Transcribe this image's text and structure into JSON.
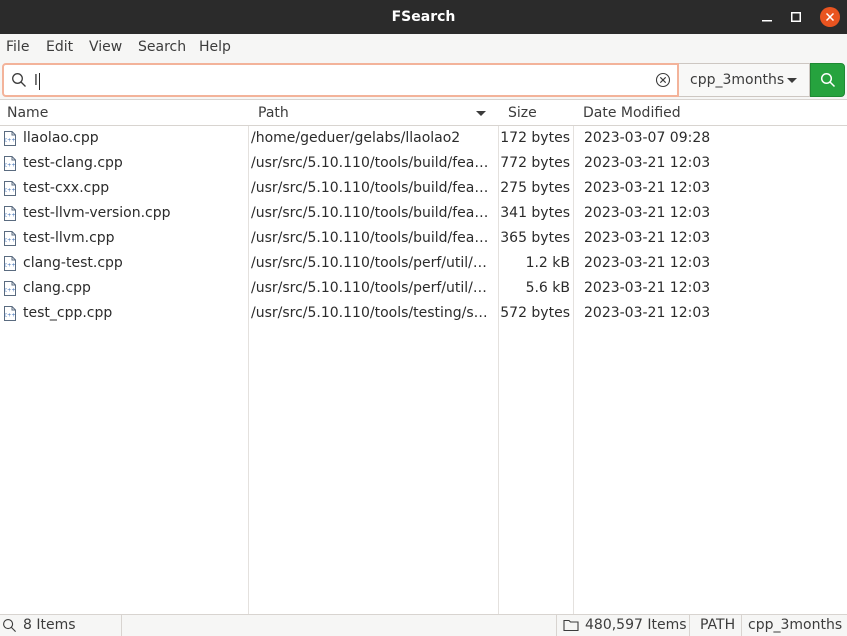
{
  "window": {
    "title": "FSearch"
  },
  "menu": [
    "File",
    "Edit",
    "View",
    "Search",
    "Help"
  ],
  "search": {
    "value": "l",
    "filter": "cpp_3months"
  },
  "columns": {
    "name": "Name",
    "path": "Path",
    "size": "Size",
    "date": "Date Modified"
  },
  "rows": [
    {
      "name": "llaolao.cpp",
      "path": "/home/geduer/gelabs/llaolao2",
      "size": "172 bytes",
      "date": "2023-03-07 09:28"
    },
    {
      "name": "test-clang.cpp",
      "path": "/usr/src/5.10.110/tools/build/fea…",
      "size": "772 bytes",
      "date": "2023-03-21 12:03"
    },
    {
      "name": "test-cxx.cpp",
      "path": "/usr/src/5.10.110/tools/build/fea…",
      "size": "275 bytes",
      "date": "2023-03-21 12:03"
    },
    {
      "name": "test-llvm-version.cpp",
      "path": "/usr/src/5.10.110/tools/build/fea…",
      "size": "341 bytes",
      "date": "2023-03-21 12:03"
    },
    {
      "name": "test-llvm.cpp",
      "path": "/usr/src/5.10.110/tools/build/fea…",
      "size": "365 bytes",
      "date": "2023-03-21 12:03"
    },
    {
      "name": "clang-test.cpp",
      "path": "/usr/src/5.10.110/tools/perf/util/…",
      "size": "1.2 kB",
      "date": "2023-03-21 12:03"
    },
    {
      "name": "clang.cpp",
      "path": "/usr/src/5.10.110/tools/perf/util/…",
      "size": "5.6 kB",
      "date": "2023-03-21 12:03"
    },
    {
      "name": "test_cpp.cpp",
      "path": "/usr/src/5.10.110/tools/testing/s…",
      "size": "572 bytes",
      "date": "2023-03-21 12:03"
    }
  ],
  "status": {
    "results": "8 Items",
    "database": "480,597 Items",
    "mode": "PATH",
    "filter": "cpp_3months"
  },
  "icons": {
    "search": "search-icon",
    "clear": "clear-icon",
    "file": "cpp-file-icon",
    "folder": "folder-icon"
  },
  "colors": {
    "titlebar": "#2b2b2b",
    "close": "#e95420",
    "search_button": "#26a33e",
    "focus_border": "#f3b39a"
  }
}
